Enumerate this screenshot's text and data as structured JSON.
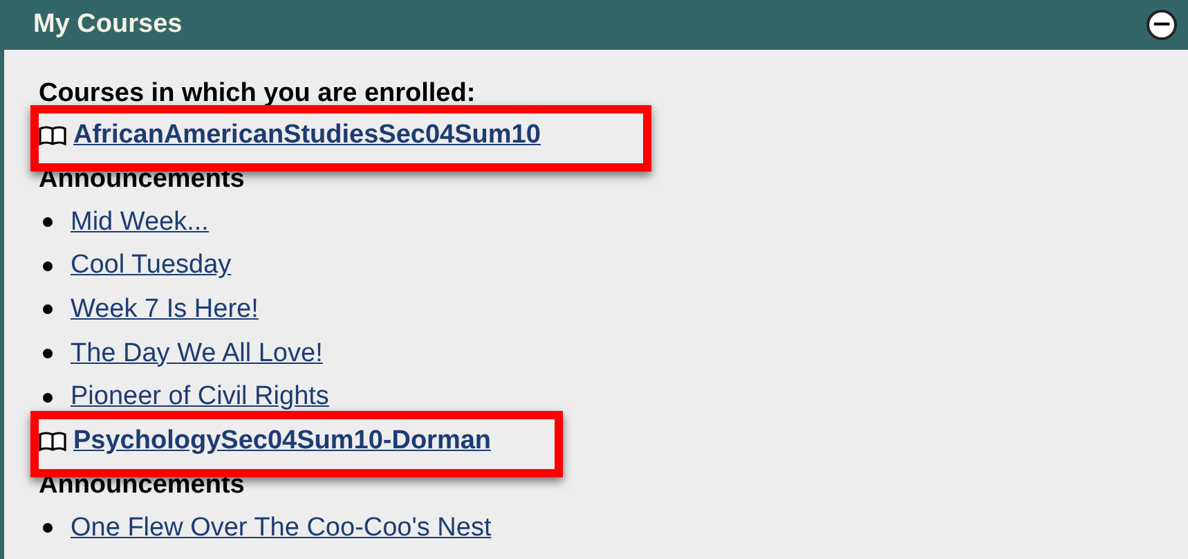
{
  "panel": {
    "title": "My Courses",
    "collapse_button": "−"
  },
  "intro": "Courses in which you are enrolled:",
  "courses": [
    {
      "title": "AfricanAmericanStudiesSec04Sum10",
      "highlighted": true,
      "announcements_heading": "Announcements",
      "announcements": [
        "Mid Week...",
        "Cool Tuesday",
        "Week 7 Is Here!",
        "The Day We All Love!",
        "Pioneer of Civil Rights"
      ]
    },
    {
      "title": "PsychologySec04Sum10-Dorman",
      "highlighted": true,
      "announcements_heading": "Announcements",
      "announcements": [
        "One Flew Over The Coo-Coo's Nest"
      ]
    }
  ]
}
